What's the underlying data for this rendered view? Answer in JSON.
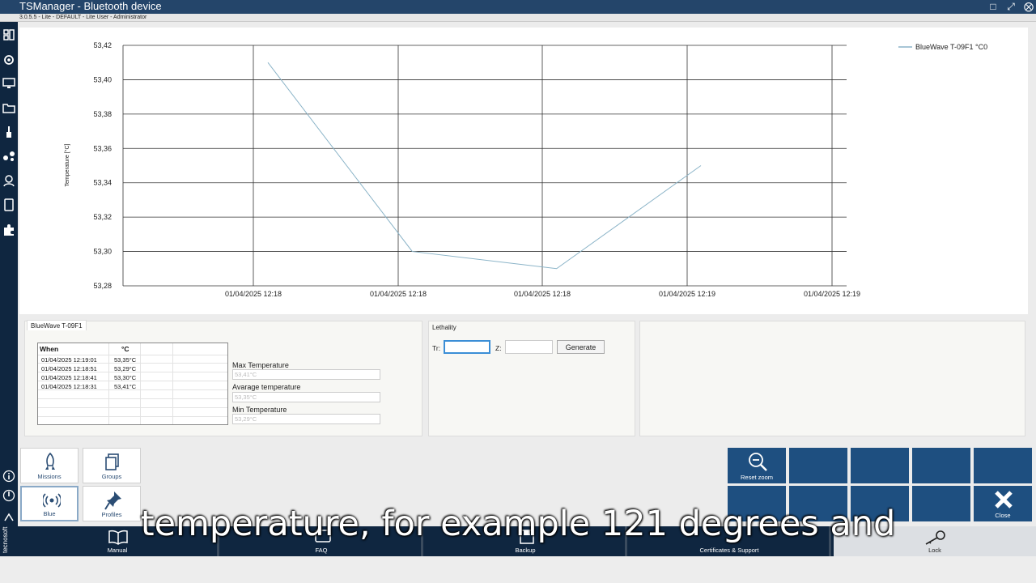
{
  "window": {
    "title": "TSManager - Bluetooth device",
    "subtitle": "3.0.5.5 - Lite - DEFAULT - Lite User - Administrator"
  },
  "sidebar": {
    "brand": "tecnosoft",
    "icons": [
      "dashboard-icon",
      "gear-icon",
      "monitor-icon",
      "folder-icon",
      "brush-icon",
      "network-icon",
      "user-icon",
      "book-icon",
      "puzzle-icon",
      "info-icon",
      "power-icon",
      "signout-icon"
    ]
  },
  "chart_data": {
    "type": "line",
    "ylabel": "Temperature [°C]",
    "xlabel": "",
    "ylim": [
      53.28,
      53.42
    ],
    "yticks": [
      "53,42",
      "53,40",
      "53,38",
      "53,36",
      "53,34",
      "53,32",
      "53,30",
      "53,28"
    ],
    "xticks": [
      "01/04/2025 12:18",
      "01/04/2025 12:18",
      "01/04/2025 12:18",
      "01/04/2025 12:19",
      "01/04/2025 12:19"
    ],
    "grid": true,
    "legend_placement": "top-right",
    "series": [
      {
        "name": "BlueWave T-09F1 °C0",
        "color": "#8bb4c8",
        "x": [
          "12:18:31",
          "12:18:41",
          "12:18:51",
          "12:19:01"
        ],
        "values": [
          53.41,
          53.3,
          53.29,
          53.35
        ]
      }
    ]
  },
  "device_panel": {
    "tab": "BlueWave T-09F1",
    "columns": [
      "When",
      "°C"
    ],
    "rows": [
      [
        "01/04/2025 12:19:01",
        "53,35°C"
      ],
      [
        "01/04/2025 12:18:51",
        "53,29°C"
      ],
      [
        "01/04/2025 12:18:41",
        "53,30°C"
      ],
      [
        "01/04/2025 12:18:31",
        "53,41°C"
      ]
    ],
    "max_label": "Max Temperature",
    "max_value": "53,41°C",
    "avg_label": "Avarage temperature",
    "avg_value": "53,35°C",
    "min_label": "Min Temperature",
    "min_value": "53,29°C"
  },
  "lethality": {
    "title": "Lethality",
    "tr_label": "Tr:",
    "tr_value": "",
    "z_label": "Z:",
    "z_value": "",
    "generate_label": "Generate"
  },
  "tiles": {
    "missions": "Missions",
    "groups": "Groups",
    "blue": "Blue",
    "profiles": "Profiles",
    "reset_zoom": "Reset zoom",
    "close": "Close"
  },
  "bottom": {
    "manual": "Manual",
    "faq": "FAQ",
    "backup": "Backup",
    "certificates": "Certificates & Support",
    "lock": "Lock"
  },
  "caption": "temperature, for example 121 degrees and",
  "colors": {
    "accent": "#1e4f80",
    "sidebar": "#0f2640",
    "line": "#8bb4c8"
  }
}
